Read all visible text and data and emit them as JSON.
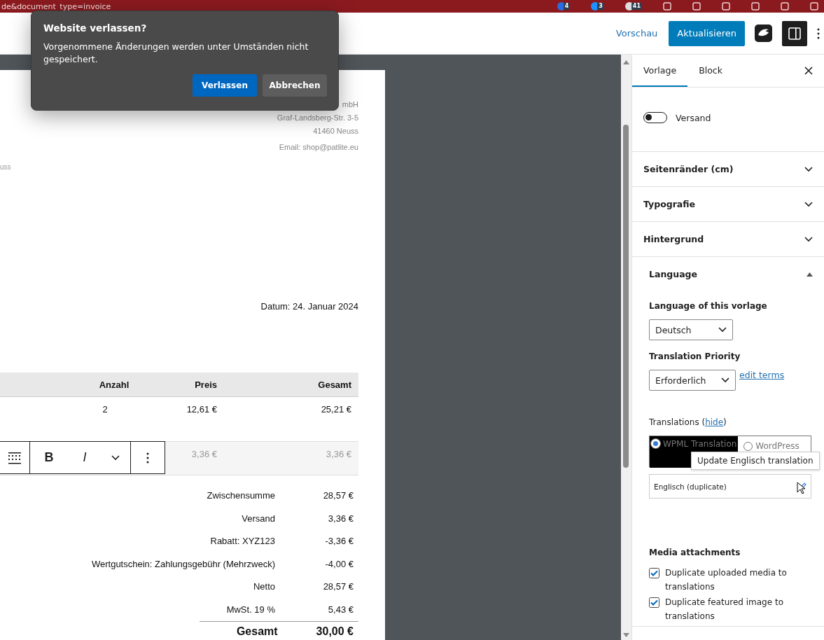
{
  "browser": {
    "url_fragment": "de&document_type=invoice",
    "extension_badges": [
      "4",
      "3",
      "41"
    ]
  },
  "header": {
    "preview_link": "Vorschau",
    "update_button": "Aktualisieren"
  },
  "document": {
    "sender_lines": [
      "mbH",
      "Graf-Landsberg-Str. 3-5",
      "41460 Neuss"
    ],
    "email": "Email: shop@patlite.eu",
    "recipient_fragment": "uss",
    "date": "Datum: 24. Januar 2024",
    "columns": [
      "Anzahl",
      "Preis",
      "Gesamt"
    ],
    "rows": [
      {
        "quantity": "2",
        "price": "12,61 €",
        "total": "25,21 €",
        "selected": false
      },
      {
        "price": "3,36 €",
        "total": "3,36 €",
        "selected": true
      }
    ],
    "block_toolbar": {
      "format_buttons": [
        "B",
        "I"
      ]
    },
    "totals": [
      {
        "label": "Zwischensumme",
        "value": "28,57 €"
      },
      {
        "label": "Versand",
        "value": "3,36 €"
      },
      {
        "label": "Rabatt: XYZ123",
        "value": "-3,36 €"
      },
      {
        "label": "Wertgutschein: Zahlungsgebühr (Mehrzweck)",
        "value": "-4,00 €"
      },
      {
        "label": "Netto",
        "value": "28,57 €"
      },
      {
        "label": "MwSt. 19 %",
        "value": "5,43 €"
      }
    ],
    "grand_total": {
      "label": "Gesamt",
      "value": "30,00 €"
    }
  },
  "sidebar": {
    "tabs": [
      {
        "label": "Vorlage",
        "selected": true
      },
      {
        "label": "Block",
        "selected": false
      }
    ],
    "toggles": [
      {
        "label": "Versand",
        "on": false
      }
    ],
    "panels": [
      {
        "title": "Seitenränder (cm)",
        "expanded": false
      },
      {
        "title": "Typografie",
        "expanded": false
      },
      {
        "title": "Hintergrund",
        "expanded": false
      },
      {
        "title": "Language",
        "expanded": true
      }
    ],
    "language": {
      "language_label": "Language of this vorlage",
      "language_value": "Deutsch",
      "priority_label": "Translation Priority",
      "priority_value": "Erforderlich",
      "edit_terms_link": "edit terms",
      "translations_prefix": "Translations (",
      "hide_link": "hide",
      "translations_suffix": ")",
      "editor_options": [
        {
          "label": "WPML Translation",
          "selected": true
        },
        {
          "label": "WordPress",
          "selected": false
        }
      ],
      "translation_rows": [
        {
          "label": "Englisch (duplicate)"
        }
      ],
      "tooltip": "Update Englisch translation",
      "media_label": "Media attachments",
      "media_options": [
        {
          "label": "Duplicate uploaded media to translations",
          "checked": true
        },
        {
          "label": "Duplicate featured image to translations",
          "checked": true
        }
      ]
    }
  },
  "dialog": {
    "title": "Website verlassen?",
    "message": "Vorgenommene Änderungen werden unter Umständen nicht gespeichert.",
    "buttons": [
      {
        "label": "Verlassen",
        "primary": true
      },
      {
        "label": "Abbrechen",
        "primary": false
      }
    ]
  }
}
